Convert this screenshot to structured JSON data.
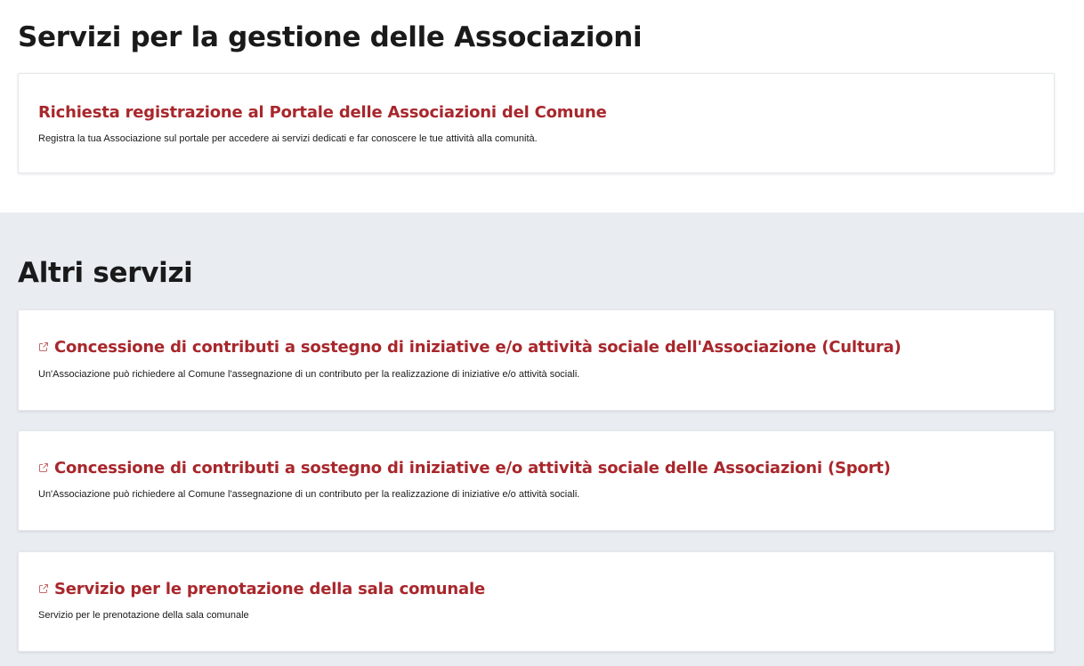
{
  "main_section": {
    "title": "Servizi per la gestione delle Associazioni",
    "cards": [
      {
        "title": "Richiesta registrazione al Portale delle Associazioni del Comune",
        "description": "Registra la tua Associazione sul portale per accedere ai servizi dedicati e far conoscere le tue attività alla comunità."
      }
    ]
  },
  "other_section": {
    "title": "Altri servizi",
    "cards": [
      {
        "icon": "external-link-icon",
        "title": "Concessione di contributi a sostegno di iniziative e/o attività sociale dell'Associazione (Cultura)",
        "description": "Un'Associazione può richiedere al Comune l'assegnazione di un contributo per la realizzazione di iniziative e/o attività sociali."
      },
      {
        "icon": "external-link-icon",
        "title": "Concessione di contributi a sostegno di iniziative e/o attività sociale delle Associazioni (Sport)",
        "description": "Un'Associazione può richiedere al Comune l'assegnazione di un contributo per la realizzazione di iniziative e/o attività sociali."
      },
      {
        "icon": "external-link-icon",
        "title": "Servizio per le prenotazione della sala comunale",
        "description": "Servizio per le prenotazione della sala comunale"
      }
    ]
  },
  "colors": {
    "accent": "#a8272c",
    "section_background": "#e9edf1",
    "text": "#1a1a1a"
  }
}
